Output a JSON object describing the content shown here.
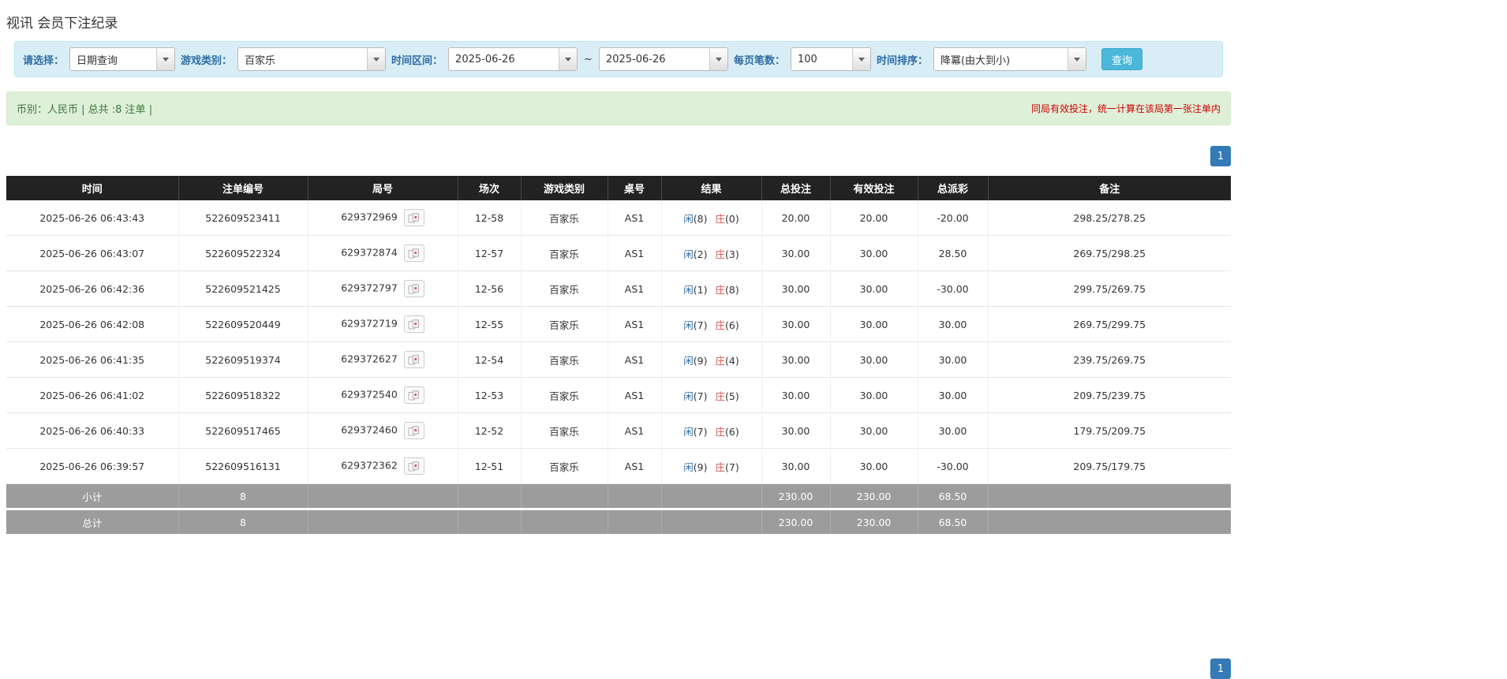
{
  "page": {
    "title": "视讯 会员下注纪录"
  },
  "filters": {
    "select_label": "请选择：",
    "select_value": "日期查询",
    "game_label": "游戏类别：",
    "game_value": "百家乐",
    "range_label": "时间区间：",
    "date_from": "2025-06-26",
    "range_separator": "~",
    "date_to": "2025-06-26",
    "per_page_label": "每页笔数：",
    "per_page_value": "100",
    "sort_label": "时间排序：",
    "sort_value": "降冪(由大到小)",
    "search_button": "查询"
  },
  "info_bar": {
    "left": "币别：人民币 | 总共 :8 注单 |",
    "right": "同局有效投注，统一计算在该局第一张注单内"
  },
  "pagination": {
    "current_page": "1"
  },
  "table": {
    "headers": [
      "时间",
      "注单编号",
      "局号",
      "场次",
      "游戏类别",
      "桌号",
      "结果",
      "总投注",
      "有效投注",
      "总派彩",
      "备注"
    ],
    "result_labels": {
      "player": "闲",
      "banker": "庄"
    },
    "rows": [
      {
        "time": "2025-06-26 06:43:43",
        "bet_id": "522609523411",
        "round_id": "629372969",
        "session": "12-58",
        "game": "百家乐",
        "table_no": "AS1",
        "player": "8",
        "banker": "0",
        "total_bet": "20.00",
        "valid_bet": "20.00",
        "payout": "-20.00",
        "note": "298.25/278.25"
      },
      {
        "time": "2025-06-26 06:43:07",
        "bet_id": "522609522324",
        "round_id": "629372874",
        "session": "12-57",
        "game": "百家乐",
        "table_no": "AS1",
        "player": "2",
        "banker": "3",
        "total_bet": "30.00",
        "valid_bet": "30.00",
        "payout": "28.50",
        "note": "269.75/298.25"
      },
      {
        "time": "2025-06-26 06:42:36",
        "bet_id": "522609521425",
        "round_id": "629372797",
        "session": "12-56",
        "game": "百家乐",
        "table_no": "AS1",
        "player": "1",
        "banker": "8",
        "total_bet": "30.00",
        "valid_bet": "30.00",
        "payout": "-30.00",
        "note": "299.75/269.75"
      },
      {
        "time": "2025-06-26 06:42:08",
        "bet_id": "522609520449",
        "round_id": "629372719",
        "session": "12-55",
        "game": "百家乐",
        "table_no": "AS1",
        "player": "7",
        "banker": "6",
        "total_bet": "30.00",
        "valid_bet": "30.00",
        "payout": "30.00",
        "note": "269.75/299.75"
      },
      {
        "time": "2025-06-26 06:41:35",
        "bet_id": "522609519374",
        "round_id": "629372627",
        "session": "12-54",
        "game": "百家乐",
        "table_no": "AS1",
        "player": "9",
        "banker": "4",
        "total_bet": "30.00",
        "valid_bet": "30.00",
        "payout": "30.00",
        "note": "239.75/269.75"
      },
      {
        "time": "2025-06-26 06:41:02",
        "bet_id": "522609518322",
        "round_id": "629372540",
        "session": "12-53",
        "game": "百家乐",
        "table_no": "AS1",
        "player": "7",
        "banker": "5",
        "total_bet": "30.00",
        "valid_bet": "30.00",
        "payout": "30.00",
        "note": "209.75/239.75"
      },
      {
        "time": "2025-06-26 06:40:33",
        "bet_id": "522609517465",
        "round_id": "629372460",
        "session": "12-52",
        "game": "百家乐",
        "table_no": "AS1",
        "player": "7",
        "banker": "6",
        "total_bet": "30.00",
        "valid_bet": "30.00",
        "payout": "30.00",
        "note": "179.75/209.75"
      },
      {
        "time": "2025-06-26 06:39:57",
        "bet_id": "522609516131",
        "round_id": "629372362",
        "session": "12-51",
        "game": "百家乐",
        "table_no": "AS1",
        "player": "9",
        "banker": "7",
        "total_bet": "30.00",
        "valid_bet": "30.00",
        "payout": "-30.00",
        "note": "209.75/179.75"
      }
    ],
    "subtotal": {
      "label": "小计",
      "count": "8",
      "total_bet": "230.00",
      "valid_bet": "230.00",
      "payout": "68.50"
    },
    "total": {
      "label": "总计",
      "count": "8",
      "total_bet": "230.00",
      "valid_bet": "230.00",
      "payout": "68.50"
    }
  },
  "colors": {
    "accent_blue": "#337ab7",
    "player_blue": "#2e6da4",
    "banker_red": "#d9534f",
    "negative_red": "#dd3333",
    "header_bg": "#222222",
    "summary_bg": "#9c9c9c",
    "filter_bg": "#d9edf7",
    "info_bg": "#dff0d8",
    "search_btn": "#4cb8d9"
  }
}
